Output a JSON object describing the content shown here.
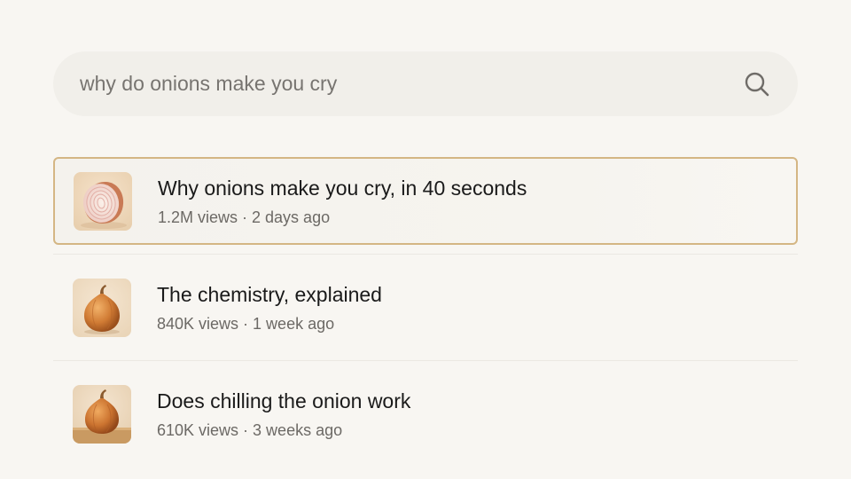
{
  "search": {
    "query": "why do onions make you cry",
    "icon": "search-icon"
  },
  "results": [
    {
      "title": "Why onions make you cry, in 40 seconds",
      "meta": "1.2M views · 2 days ago",
      "thumbnail": "onion-halved-thumbnail",
      "selected": true
    },
    {
      "title": "The chemistry, explained",
      "meta": "840K views · 1 week ago",
      "thumbnail": "whole-onion-thumbnail",
      "selected": false
    },
    {
      "title": "Does chilling the onion work",
      "meta": "610K views · 3 weeks ago",
      "thumbnail": "onion-on-board-thumbnail",
      "selected": false
    }
  ],
  "colors": {
    "background": "#f8f6f2",
    "search_bg": "#f1efea",
    "selected_border": "#d4b684",
    "title_text": "#1a1a1a",
    "meta_text": "#6c6965"
  }
}
